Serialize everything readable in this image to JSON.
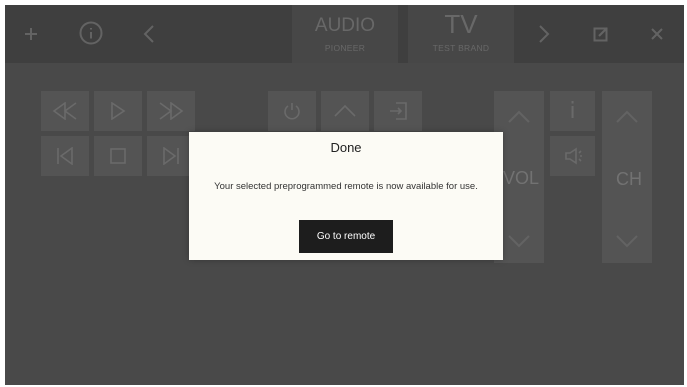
{
  "devices": [
    {
      "type": "AUDIO",
      "brand": "PIONEER"
    },
    {
      "type": "TV",
      "brand": "TEST BRAND"
    }
  ],
  "icons": {
    "add": "plus-icon",
    "info": "info-icon",
    "prev": "chevron-left-icon",
    "next": "chevron-right-icon",
    "edit": "edit-icon",
    "close": "close-icon"
  },
  "remote": {
    "info_label": "i",
    "volume_label": "VOL",
    "channel_label": "CH"
  },
  "dialog": {
    "title": "Done",
    "message": "Your selected preprogrammed remote is now available for use.",
    "button_label": "Go to remote"
  },
  "colors": {
    "background": "#494949",
    "dialog_bg": "#fcfbf5",
    "primary_button": "#1d1d1d"
  }
}
